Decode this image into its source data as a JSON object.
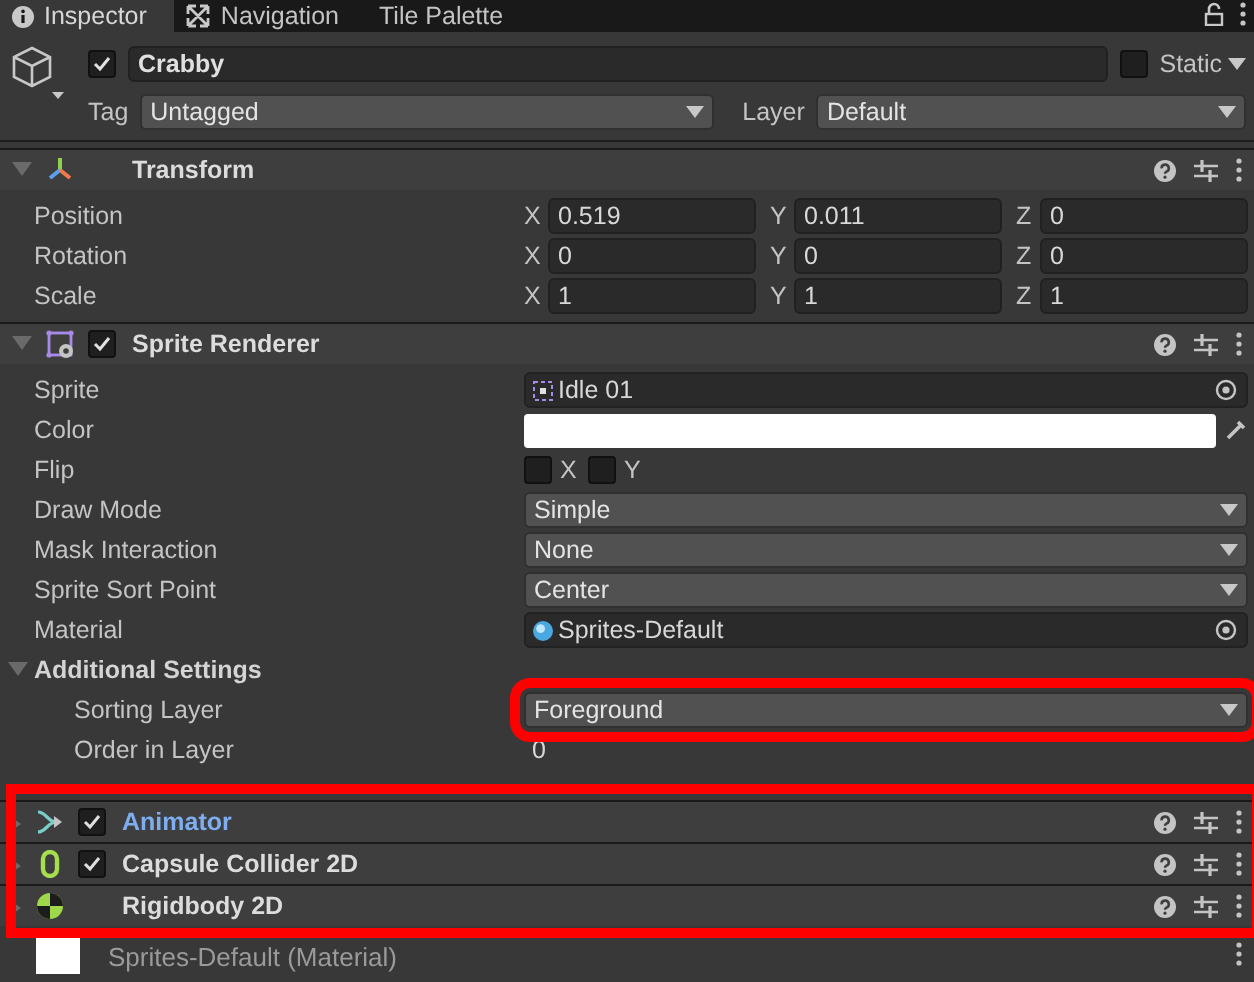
{
  "tabs": [
    {
      "label": "Inspector",
      "selected": true
    },
    {
      "label": "Navigation",
      "selected": false
    },
    {
      "label": "Tile Palette",
      "selected": false
    }
  ],
  "game_object": {
    "active": true,
    "name": "Crabby",
    "static": false,
    "static_label": "Static",
    "tag_label": "Tag",
    "tag": "Untagged",
    "layer_label": "Layer",
    "layer": "Default"
  },
  "components": [
    {
      "kind": "transform",
      "title": "Transform",
      "expanded": true,
      "properties": [
        {
          "kind": "vector",
          "label": "Position",
          "values": [
            {
              "axis": "X",
              "value": "0.519"
            },
            {
              "axis": "Y",
              "value": "0.011"
            },
            {
              "axis": "Z",
              "value": "0"
            }
          ]
        },
        {
          "kind": "vector",
          "label": "Rotation",
          "values": [
            {
              "axis": "X",
              "value": "0"
            },
            {
              "axis": "Y",
              "value": "0"
            },
            {
              "axis": "Z",
              "value": "0"
            }
          ]
        },
        {
          "kind": "vector",
          "label": "Scale",
          "values": [
            {
              "axis": "X",
              "value": "1"
            },
            {
              "axis": "Y",
              "value": "1"
            },
            {
              "axis": "Z",
              "value": "1"
            }
          ]
        }
      ]
    },
    {
      "kind": "sprite_renderer",
      "title": "Sprite Renderer",
      "enabled": true,
      "expanded": true,
      "properties": [
        {
          "kind": "sprite_field",
          "label": "Sprite",
          "value": "Idle 01"
        },
        {
          "kind": "color",
          "label": "Color",
          "color": "#ffffff"
        },
        {
          "kind": "flip",
          "label": "Flip",
          "toggles": [
            {
              "axis": "X",
              "checked": false
            },
            {
              "axis": "Y",
              "checked": false
            }
          ]
        },
        {
          "kind": "dropdown",
          "label": "Draw Mode",
          "value": "Simple"
        },
        {
          "kind": "dropdown",
          "label": "Mask Interaction",
          "value": "None"
        },
        {
          "kind": "dropdown",
          "label": "Sprite Sort Point",
          "value": "Center"
        },
        {
          "kind": "material_field",
          "label": "Material",
          "value": "Sprites-Default"
        },
        {
          "kind": "section",
          "label": "Additional Settings",
          "expanded": true,
          "children": [
            {
              "kind": "dropdown",
              "label": "Sorting Layer",
              "value": "Foreground",
              "outlined": true
            },
            {
              "kind": "number",
              "label": "Order in Layer",
              "value": "0"
            }
          ]
        }
      ]
    }
  ],
  "collapsed_components": {
    "outlined": true,
    "items": [
      {
        "kind": "animator",
        "title": "Animator",
        "enabled": true,
        "selected": true
      },
      {
        "kind": "capsule_collider",
        "title": "Capsule Collider 2D",
        "enabled": true,
        "selected": false
      },
      {
        "kind": "rigidbody",
        "title": "Rigidbody 2D",
        "selected": false
      }
    ]
  },
  "preview": {
    "title": "Sprites-Default (Material)"
  }
}
